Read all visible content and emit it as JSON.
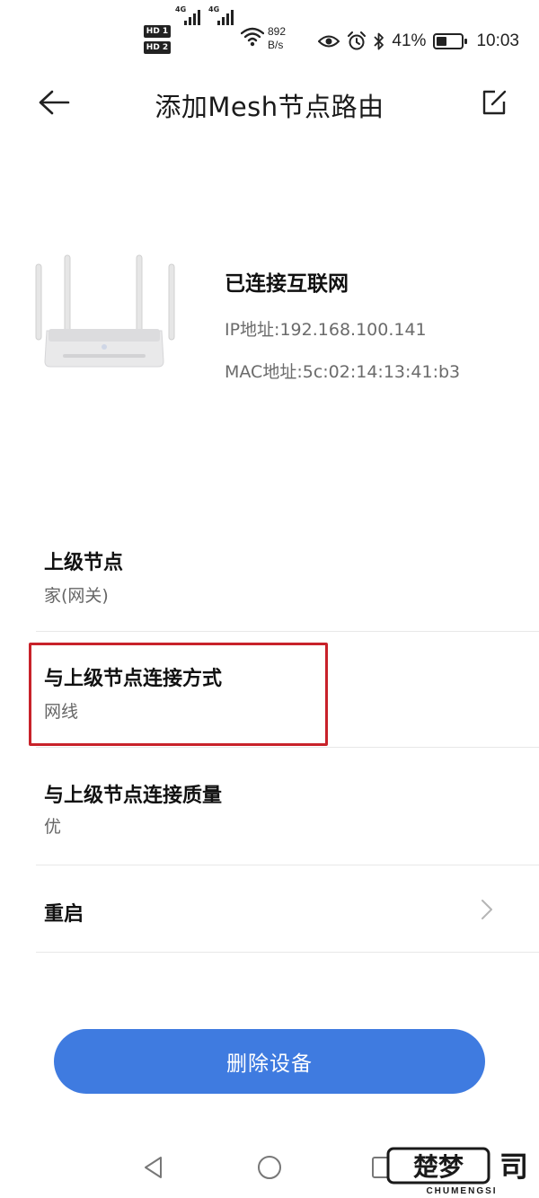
{
  "status_bar": {
    "sim1_label": "HD 1",
    "sim2_label": "HD 2",
    "net1": "4G",
    "net2": "4G",
    "speed_value": "892",
    "speed_unit": "B/s",
    "battery_percent": "41%",
    "battery_level": 0.41,
    "time": "10:03"
  },
  "header": {
    "title": "添加Mesh节点路由"
  },
  "device": {
    "status": "已连接互联网",
    "ip": "IP地址:192.168.100.141",
    "mac": "MAC地址:5c:02:14:13:41:b3"
  },
  "settings": [
    {
      "title": "上级节点",
      "value": "家(网关)"
    },
    {
      "title": "与上级节点连接方式",
      "value": "网线"
    },
    {
      "title": "与上级节点连接质量",
      "value": "优"
    },
    {
      "title": "重启",
      "value": ""
    }
  ],
  "actions": {
    "delete_label": "删除设备"
  },
  "watermark": {
    "brand_text": "楚梦",
    "latin_text": "CHUMENGSI"
  },
  "colors": {
    "primary_button": "#3f7be0",
    "highlight_border": "#c8222a",
    "text_primary": "#111111",
    "text_secondary": "#666666"
  },
  "icons": {
    "back": "arrow-left-icon",
    "edit": "edit-square-icon",
    "chevron": "chevron-right-icon",
    "nav_back": "triangle-back-icon",
    "nav_home": "circle-home-icon",
    "nav_recent": "square-recent-icon"
  }
}
